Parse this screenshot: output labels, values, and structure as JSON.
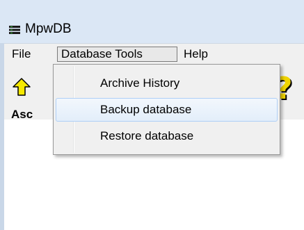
{
  "window": {
    "title": "MpwDB"
  },
  "menubar": {
    "file": "File",
    "database_tools": "Database Tools",
    "help": "Help"
  },
  "toolbar": {
    "partial_label": "Asc"
  },
  "dropdown": {
    "items": [
      {
        "label": "Archive History",
        "highlighted": false
      },
      {
        "label": "Backup database",
        "highlighted": true
      },
      {
        "label": "Restore database",
        "highlighted": false
      }
    ]
  },
  "icons": {
    "app": "database-icon",
    "up": "up-arrow-icon",
    "help": "help-question-icon"
  },
  "colors": {
    "titlebar": "#dbe7f5",
    "menu_bg": "#f0f0f0",
    "highlight_border": "#aecff7",
    "up_arrow": "#f5e800",
    "help_mark": "#f0d400"
  }
}
